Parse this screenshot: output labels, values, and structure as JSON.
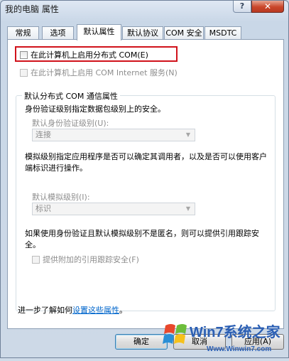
{
  "window": {
    "title": "我的电脑 属性",
    "help_label": "?",
    "close_label": "✕"
  },
  "tabs": [
    {
      "label": "常规",
      "active": false
    },
    {
      "label": "选项",
      "active": false
    },
    {
      "label": "默认属性",
      "active": true
    },
    {
      "label": "默认协议",
      "active": false
    },
    {
      "label": "COM 安全",
      "active": false
    },
    {
      "label": "MSDTC",
      "active": false
    }
  ],
  "options": {
    "enable_dcom": {
      "label": "在此计算机上启用分布式 COM(E)",
      "checked": false,
      "enabled": true
    },
    "enable_com_internet": {
      "label": "在此计算机上启用 COM Internet 服务(N)",
      "checked": false,
      "enabled": false
    }
  },
  "group": {
    "title": "默认分布式 COM 通信属性",
    "auth_desc": "身份验证级别指定数据包级别上的安全。",
    "auth_label": "默认身份验证级别(U):",
    "auth_value": "连接",
    "impersonation_desc": "模拟级别指定应用程序是否可以确定其调用者，以及是否可以使用客户端标识进行操作。",
    "impersonation_label": "默认模拟级别(I):",
    "impersonation_value": "标识",
    "reference_desc": "如果使用身份验证且默认模拟级别不是匿名，则可以提供引用跟踪安全。",
    "reference_option": {
      "label": "提供附加的引用跟踪安全(F)",
      "checked": false,
      "enabled": false
    }
  },
  "footer": {
    "learn_more_prefix": "进一步了解如何",
    "learn_more_link": "设置这些属性",
    "learn_more_suffix": "。"
  },
  "buttons": {
    "ok": "确定",
    "cancel": "取消",
    "apply": "应用(A)"
  },
  "watermark": {
    "brand": "Win7系统之家",
    "url": "Www.Winwin7.com"
  },
  "colors": {
    "highlight_box": "#d0121b",
    "link": "#0066cc",
    "close_button": "#c9462a"
  }
}
